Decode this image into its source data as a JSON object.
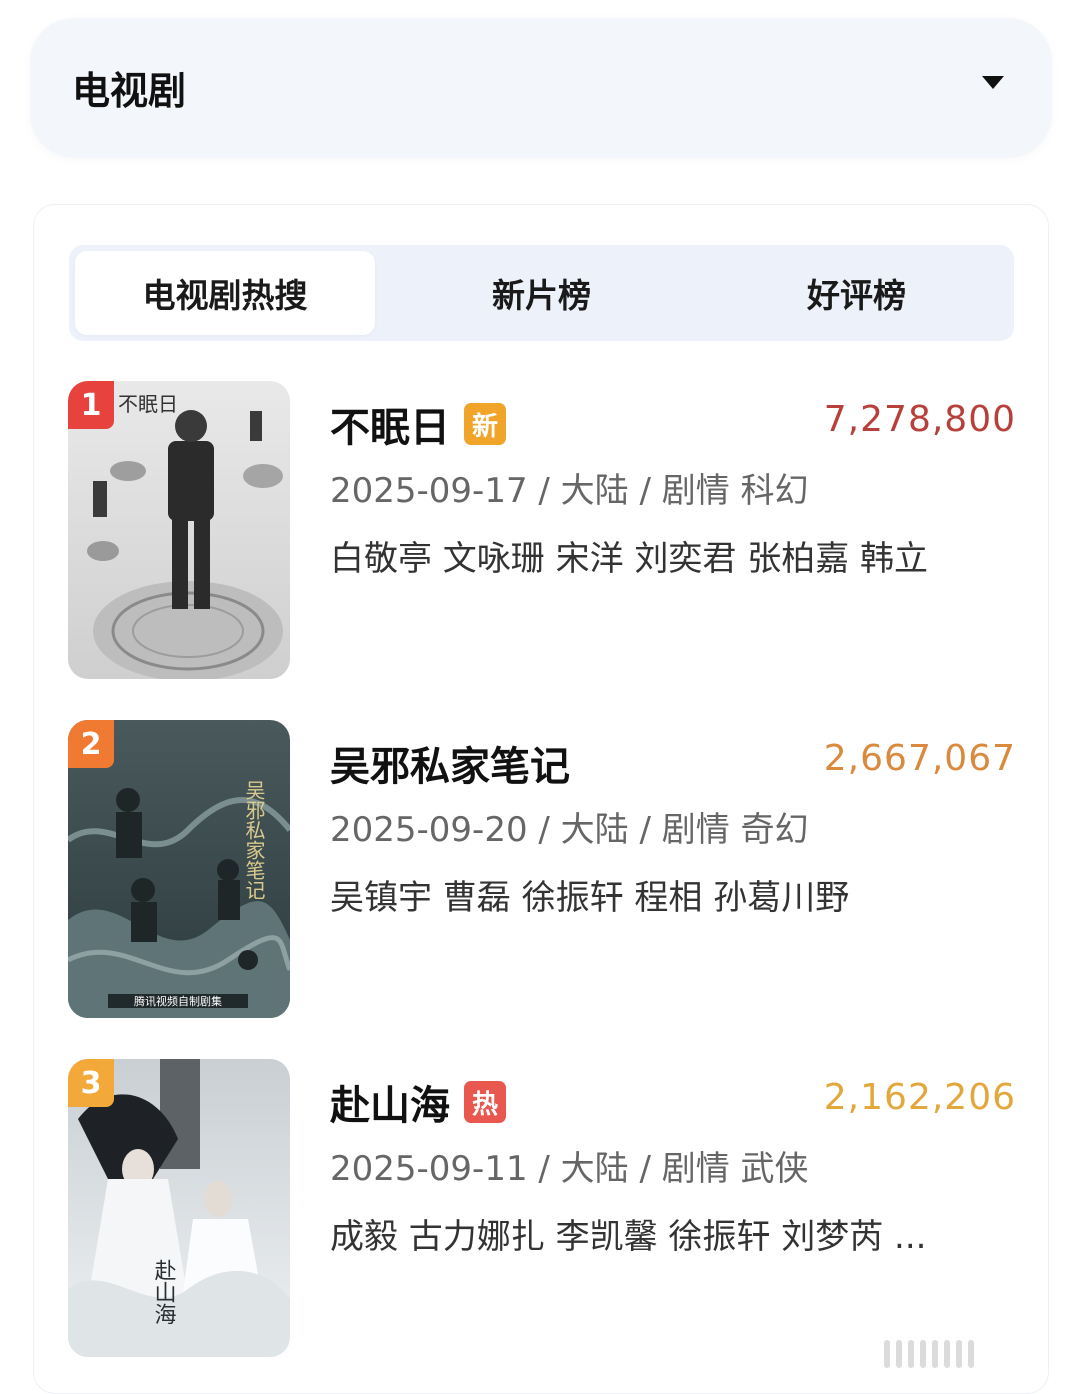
{
  "category": {
    "label": "电视剧"
  },
  "tabs": [
    {
      "label": "电视剧热搜",
      "active": true
    },
    {
      "label": "新片榜",
      "active": false
    },
    {
      "label": "好评榜",
      "active": false
    }
  ],
  "items": [
    {
      "rank": "1",
      "rank_color": "#e8423f",
      "title": "不眠日",
      "badge": "新",
      "badge_color": "#f0a52a",
      "heat": "7,278,800",
      "heat_color": "#b8403a",
      "meta": "2025-09-17 / 大陆 / 剧情 科幻",
      "cast": "白敬亭 文咏珊 宋洋 刘奕君 张柏嘉 韩立",
      "poster_text": "不眠日"
    },
    {
      "rank": "2",
      "rank_color": "#f07a32",
      "title": "吴邪私家笔记",
      "badge": "",
      "badge_color": "",
      "heat": "2,667,067",
      "heat_color": "#d98a3c",
      "meta": "2025-09-20 / 大陆 / 剧情 奇幻",
      "cast": "吴镇宇 曹磊 徐振轩 程相 孙葛川野",
      "poster_text": "吴邪私家笔记",
      "poster_caption": "腾讯视频自制剧集"
    },
    {
      "rank": "3",
      "rank_color": "#f3a93a",
      "title": "赴山海",
      "badge": "热",
      "badge_color": "#e8584f",
      "heat": "2,162,206",
      "heat_color": "#e3a83c",
      "meta": "2025-09-11 / 大陆 / 剧情 武侠",
      "cast": "成毅 古力娜扎 李凯馨 徐振轩 刘梦芮 ...",
      "poster_text": "赴山海"
    }
  ]
}
